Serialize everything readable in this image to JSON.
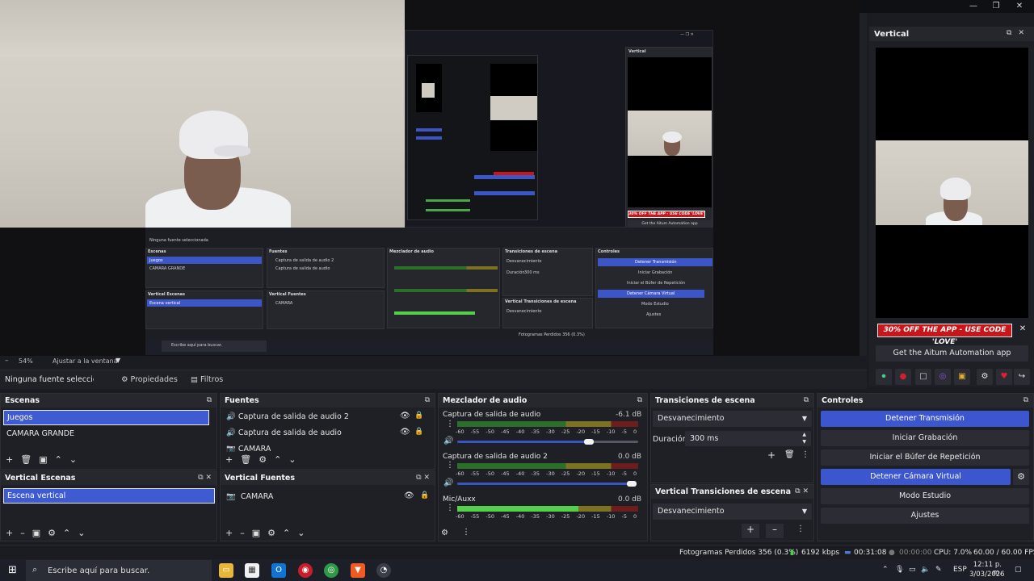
{
  "window": {
    "minimize": "—",
    "restore": "❐",
    "close": "✕"
  },
  "zoom": {
    "percent": "54%",
    "fit": "Ajustar a la ventana"
  },
  "sourcebar": {
    "selected_source": "Ninguna fuente seleccionada",
    "properties": "Propiedades",
    "filters": "Filtros"
  },
  "scenes": {
    "title": "Escenas",
    "items": [
      "Juegos",
      "CAMARA GRANDE"
    ]
  },
  "sources": {
    "title": "Fuentes",
    "items": [
      "Captura de salida de audio 2",
      "Captura de salida de audio",
      "CAMARA"
    ]
  },
  "vertical_scenes": {
    "title": "Vertical Escenas",
    "items": [
      "Escena vertical"
    ]
  },
  "vertical_sources": {
    "title": "Vertical Fuentes",
    "items": [
      "CAMARA"
    ]
  },
  "mixer": {
    "title": "Mezclador de audio",
    "ticks": "-60 -55 -50 -45 -40 -35 -30 -25 -20 -15 -10 -5 0",
    "channels": [
      {
        "name": "Captura de salida de audio",
        "db": "-6.1 dB",
        "volume": 0.98
      },
      {
        "name": "Captura de salida de audio 2",
        "db": "0.0 dB",
        "volume": 1.0
      },
      {
        "name": "Mic/Auxx",
        "db": "0.0 dB",
        "volume": 1.0
      }
    ]
  },
  "transitions": {
    "title": "Transiciones de escena",
    "selected": "Desvanecimiento",
    "duration_label": "Duración",
    "duration_value": "300 ms"
  },
  "vertical_transitions": {
    "title": "Vertical Transiciones de escena",
    "selected": "Desvanecimiento"
  },
  "controls": {
    "title": "Controles",
    "buttons": [
      "Detener Transmisión",
      "Iniciar Grabación",
      "Iniciar el Búfer de Repetición",
      "Detener Cámara Virtual",
      "Modo Estudio",
      "Ajustes"
    ]
  },
  "vertical_dock": {
    "title": "Vertical",
    "promo": "30% OFF THE APP - USE CODE 'LOVE'",
    "aitum": "Get the Aitum Automation app"
  },
  "status": {
    "dropped": "Fotogramas Perdidos 356 (0.3%)",
    "bitrate": "6192 kbps",
    "stream_time": "00:31:08",
    "rec_time": "00:00:00",
    "cpu": "CPU: 7.0%",
    "fps": "60.00 / 60.00 FPS"
  },
  "taskbar": {
    "search_placeholder": "Escribe aquí para buscar.",
    "lang": "ESP",
    "time": "12:11 p. m.",
    "date": "3/03/2026"
  },
  "nested": {
    "fuente": "Ninguna fuente seleccionada",
    "escenas": "Escenas",
    "fuentes": "Fuentes",
    "mezclador": "Mezclador de audio",
    "transiciones": "Transiciones de escena",
    "controles": "Controles",
    "juegos": "Juegos",
    "camara_grande": "CAMARA GRANDE",
    "cap2": "Captura de salida de audio 2",
    "cap1": "Captura de salida de audio",
    "vert_escenas": "Vertical Escenas",
    "vert_fuentes": "Vertical Fuentes",
    "escena_vertical": "Escena vertical",
    "camara": "CAMARA",
    "desv": "Desvanecimiento",
    "vert_trans": "Vertical Transiciones de escena",
    "duracion": "Duración",
    "dur_val": "300 ms",
    "btns": [
      "Detener Transmisión",
      "Iniciar Grabación",
      "Iniciar el Búfer de Repetición",
      "Detener Cámara Virtual",
      "Modo Estudio",
      "Ajustes"
    ],
    "status": "Fotogramas Perdidos 356 (0.3%)",
    "search": "Escribe aquí para buscar.",
    "vertical": "Vertical",
    "promo": "30% OFF THE APP - USE CODE 'LOVE'",
    "aitum": "Get the Aitum Automation app"
  }
}
